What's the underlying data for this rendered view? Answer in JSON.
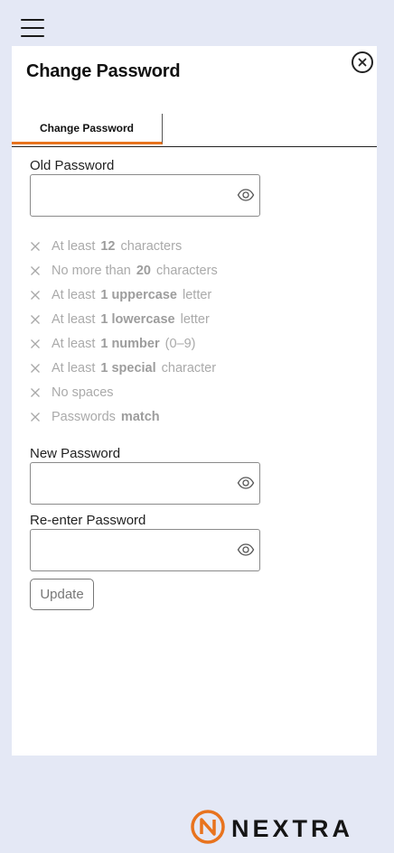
{
  "app": {
    "menu_icon": "hamburger-menu-icon",
    "brand_name": "NEXTRA",
    "brand_icon": "nextra-logo-icon",
    "brand_color": "#e8731e"
  },
  "panel": {
    "title": "Change Password",
    "close_icon": "close-circle-icon"
  },
  "tabs": [
    {
      "label": "Change Password",
      "active": true
    }
  ],
  "fields": {
    "old_password": {
      "label": "Old Password",
      "value": "",
      "icon": "eye-icon"
    },
    "new_password": {
      "label": "New Password",
      "value": "",
      "icon": "eye-icon"
    },
    "reenter_password": {
      "label": "Re-enter Password",
      "value": "",
      "icon": "eye-icon"
    }
  },
  "rules": [
    {
      "pre": "At least",
      "bold": "12",
      "post": "characters"
    },
    {
      "pre": "No more than",
      "bold": "20",
      "post": "characters"
    },
    {
      "pre": "At least",
      "bold": "1 uppercase",
      "post": "letter"
    },
    {
      "pre": "At least",
      "bold": "1 lowercase",
      "post": "letter"
    },
    {
      "pre": "At least",
      "bold": "1 number",
      "post": "(0–9)"
    },
    {
      "pre": "At least",
      "bold": "1 special",
      "post": "character"
    },
    {
      "pre": "No spaces",
      "bold": "",
      "post": ""
    },
    {
      "pre": "Passwords",
      "bold": "match",
      "post": ""
    }
  ],
  "actions": {
    "update_label": "Update"
  },
  "colors": {
    "accent": "#e8731e",
    "background": "#e4e8f5",
    "rule_text": "#aaaaaa"
  }
}
